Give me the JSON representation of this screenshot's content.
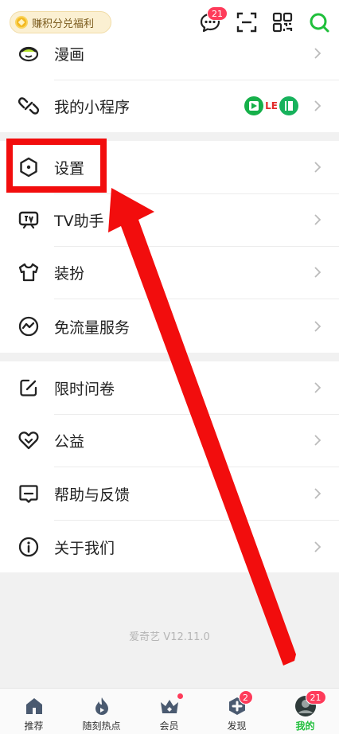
{
  "topbar": {
    "welfare_label": "赚积分兑福利",
    "message_badge": "21"
  },
  "menu_group1": {
    "items": [
      {
        "label": "漫画",
        "icon": "comic-icon"
      },
      {
        "label": "我的小程序",
        "icon": "link-icon"
      }
    ],
    "mini_app_text": "LE"
  },
  "menu_group2": {
    "items": [
      {
        "label": "设置",
        "icon": "settings-icon"
      },
      {
        "label": "TV助手",
        "icon": "tv-icon"
      },
      {
        "label": "装扮",
        "icon": "tshirt-icon"
      },
      {
        "label": "免流量服务",
        "icon": "traffic-icon"
      }
    ]
  },
  "menu_group3": {
    "items": [
      {
        "label": "限时问卷",
        "icon": "edit-icon"
      },
      {
        "label": "公益",
        "icon": "heart-icon"
      },
      {
        "label": "帮助与反馈",
        "icon": "feedback-icon"
      },
      {
        "label": "关于我们",
        "icon": "info-icon"
      }
    ]
  },
  "footer": {
    "version": "爱奇艺 V12.11.0"
  },
  "bottom_nav": {
    "tabs": [
      {
        "label": "推荐",
        "icon": "home-icon"
      },
      {
        "label": "随刻热点",
        "icon": "flame-icon"
      },
      {
        "label": "会员",
        "icon": "crown-icon"
      },
      {
        "label": "发现",
        "icon": "discover-icon",
        "badge": "2"
      },
      {
        "label": "我的",
        "icon": "profile-icon",
        "badge": "21",
        "active": true
      }
    ]
  },
  "colors": {
    "accent_green": "#1fbf3b",
    "highlight_red": "#f20d0d",
    "badge_red": "#fe3b5a"
  }
}
